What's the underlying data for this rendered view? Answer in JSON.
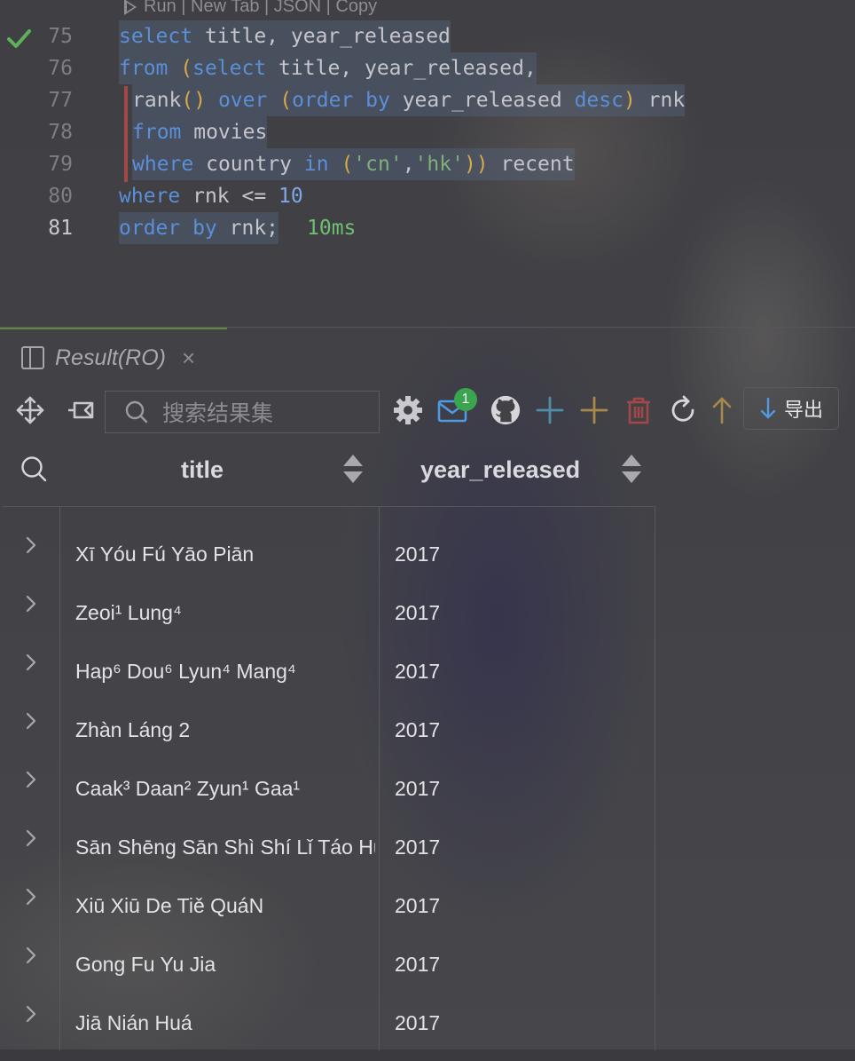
{
  "codelens": {
    "text": "Run | New Tab | JSON | Copy"
  },
  "editor": {
    "line_numbers": [
      "75",
      "76",
      "77",
      "78",
      "79",
      "80",
      "81"
    ],
    "lines": [
      [
        [
          "kw",
          "select"
        ],
        [
          "id",
          " title, year_released"
        ]
      ],
      [
        [
          "kw",
          "from"
        ],
        [
          "id",
          " "
        ],
        [
          "par",
          "("
        ],
        [
          "kw",
          "select"
        ],
        [
          "id",
          " title, year_released,"
        ]
      ],
      [
        [
          "id",
          "rank"
        ],
        [
          "par",
          "()"
        ],
        [
          "id",
          " "
        ],
        [
          "kw",
          "over"
        ],
        [
          "id",
          " "
        ],
        [
          "par",
          "("
        ],
        [
          "kw",
          "order by"
        ],
        [
          "id",
          " year_released "
        ],
        [
          "kw",
          "desc"
        ],
        [
          "par",
          ")"
        ],
        [
          "id",
          " rnk"
        ]
      ],
      [
        [
          "kw",
          "from"
        ],
        [
          "id",
          " movies"
        ]
      ],
      [
        [
          "kw",
          "where"
        ],
        [
          "id",
          " country "
        ],
        [
          "kw",
          "in"
        ],
        [
          "id",
          " "
        ],
        [
          "par",
          "("
        ],
        [
          "str",
          "'cn'"
        ],
        [
          "id",
          ","
        ],
        [
          "str",
          "'hk'"
        ],
        [
          "par",
          "))"
        ],
        [
          "id",
          " recent"
        ]
      ],
      [
        [
          "kw",
          "where"
        ],
        [
          "id",
          " rnk <= "
        ],
        [
          "num",
          "10"
        ]
      ],
      [
        [
          "kw",
          "order by"
        ],
        [
          "id",
          " rnk;"
        ]
      ]
    ],
    "timing": "10ms"
  },
  "result_tab": {
    "label": "Result(RO)",
    "close": "×"
  },
  "toolbar": {
    "search_placeholder": "搜索结果集",
    "notification_count": "1",
    "export_label": "导出"
  },
  "table": {
    "columns": [
      "title",
      "year_released"
    ],
    "rows": [
      {
        "title": "Xī Yóu Fú Yāo Piān",
        "year_released": "2017"
      },
      {
        "title": "Zeoi¹ Lung⁴",
        "year_released": "2017"
      },
      {
        "title": "Hap⁶ Dou⁶ Lyun⁴ Mang⁴",
        "year_released": "2017"
      },
      {
        "title": "Zhàn Láng 2",
        "year_released": "2017"
      },
      {
        "title": "Caak³ Daan² Zyun¹ Gaa¹",
        "year_released": "2017"
      },
      {
        "title": "Sān Shēng Sān Shì Shí Lǐ Táo Huā",
        "year_released": "2017"
      },
      {
        "title": "Xiū Xiū De Tiě QuáN",
        "year_released": "2017"
      },
      {
        "title": "Gong Fu Yu Jia",
        "year_released": "2017"
      },
      {
        "title": "Jiā Nián Huá",
        "year_released": "2017"
      }
    ]
  },
  "colors": {
    "keyword": "#5b8fd8",
    "string": "#7fb07a",
    "accent_green": "#3aa44f",
    "delete_red": "#a34848"
  }
}
